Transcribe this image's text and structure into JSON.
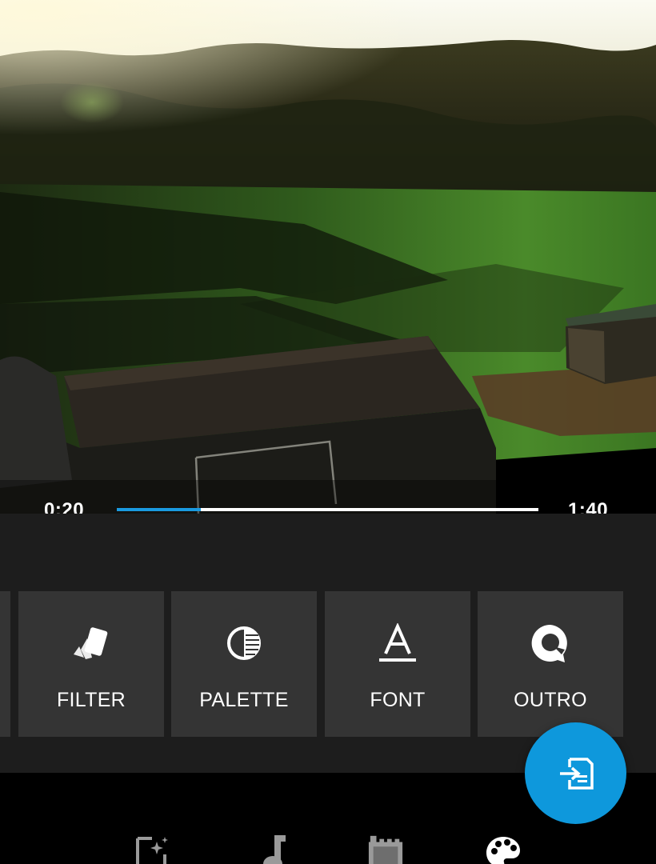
{
  "player": {
    "current_time": "0:20",
    "total_time": "1:40",
    "progress": 0.2
  },
  "style_tiles": [
    {
      "label": "FILTER",
      "icon": "filter-cards-icon"
    },
    {
      "label": "PALETTE",
      "icon": "palette-contrast-icon"
    },
    {
      "label": "FONT",
      "icon": "font-underline-a-icon"
    },
    {
      "label": "OUTRO",
      "icon": "outro-speech-q-icon"
    }
  ],
  "fab": {
    "icon": "export-save-icon"
  },
  "bottom_nav": [
    {
      "icon": "magic-edit-icon",
      "active": false
    },
    {
      "icon": "music-note-icon",
      "active": false
    },
    {
      "icon": "film-strip-icon",
      "active": false
    },
    {
      "icon": "paint-palette-icon",
      "active": true
    }
  ],
  "colors": {
    "accent": "#0e98dc",
    "panel": "#1d1d1d",
    "tile": "#343434",
    "progress_fill": "#1a9ae0"
  }
}
